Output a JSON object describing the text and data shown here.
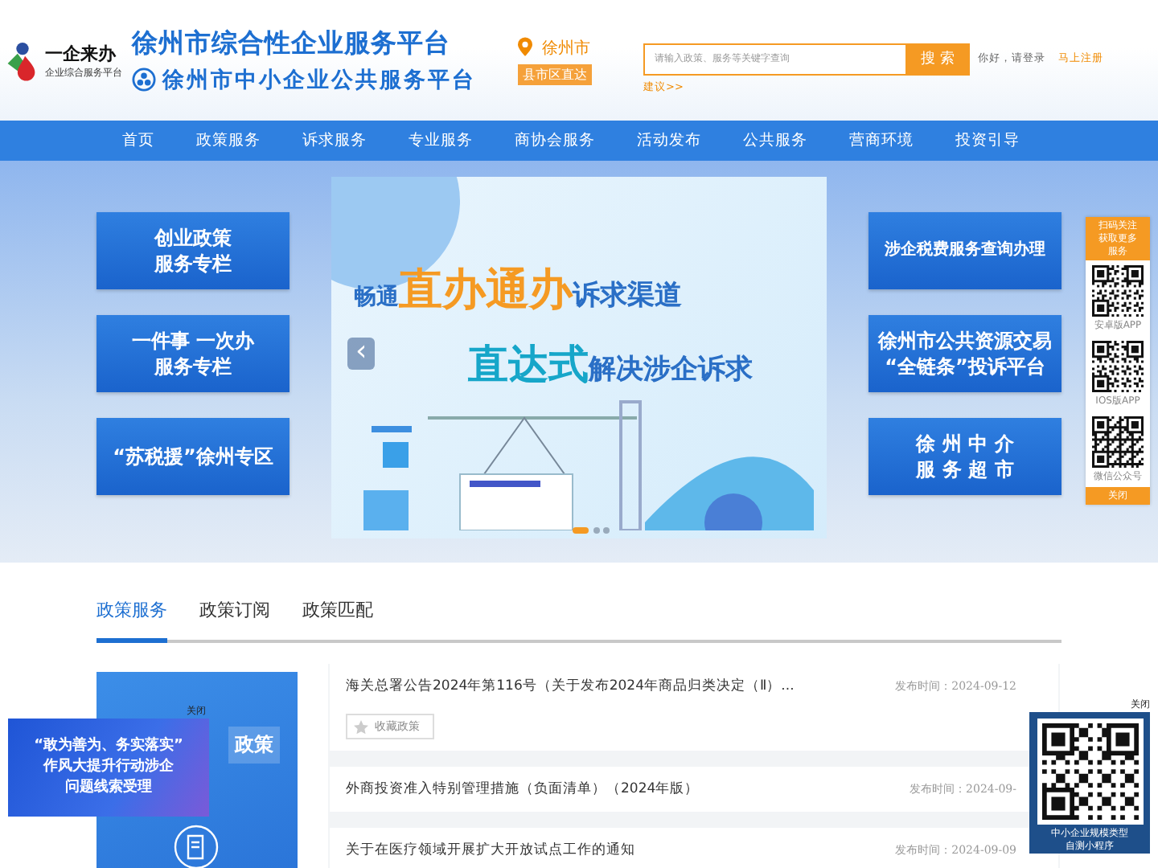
{
  "header": {
    "logo": {
      "name": "一企来办",
      "tagline": "企业综合服务平台"
    },
    "title": "徐州市综合性企业服务平台",
    "subtitle": "徐州市中小企业公共服务平台",
    "location": "徐州市",
    "location_badge": "县市区直达",
    "search": {
      "placeholder": "请输入政策、服务等关键字查询",
      "button": "搜 索"
    },
    "greeting": "你好，请登录",
    "register": "马上注册",
    "suggest": "建议>>"
  },
  "nav": [
    {
      "label": "首页",
      "selected": false
    },
    {
      "label": "政策服务",
      "selected": false
    },
    {
      "label": "诉求服务",
      "selected": false
    },
    {
      "label": "专业服务",
      "selected": false
    },
    {
      "label": "商协会服务",
      "selected": false
    },
    {
      "label": "活动发布",
      "selected": false
    },
    {
      "label": "公共服务",
      "selected": false
    },
    {
      "label": "营商环境",
      "selected": false
    },
    {
      "label": "投资引导",
      "selected": false
    }
  ],
  "banner": {
    "left_links": [
      [
        "创业政策",
        "服务专栏"
      ],
      [
        "一件事 一次办",
        "服务专栏"
      ],
      [
        "“苏税援”徐州专区"
      ]
    ],
    "slide": {
      "line1_prefix": "畅通",
      "line1_highlight": "直办通办",
      "line1_suffix": "诉求渠道",
      "line2_highlight": "直达式",
      "line2_suffix": "解决涉企诉求",
      "prev": "‹"
    },
    "right_links": [
      [
        "涉企税费服务查询办理"
      ],
      [
        "徐州市公共资源交易",
        "“全链条”投诉平台"
      ],
      [
        "徐 州 中 介",
        "服 务 超 市"
      ]
    ]
  },
  "qr_float": {
    "header": [
      "扫码关注",
      "获取更多",
      "服务"
    ],
    "items": [
      "安卓版APP",
      "IOS版APP",
      "微信公众号"
    ],
    "close": "关闭"
  },
  "policy": {
    "tabs": [
      {
        "label": "政策服务",
        "selected": true
      },
      {
        "label": "政策订阅",
        "selected": false
      },
      {
        "label": "政策匹配",
        "selected": false
      }
    ],
    "side_image_text": "政策",
    "items": [
      {
        "title": "海关总署公告2024年第116号（关于发布2024年商品归类决定（Ⅱ）...",
        "date": "发布时间：2024-09-12",
        "action": "收藏政策"
      },
      {
        "title": "外商投资准入特别管理措施（负面清单）（2024年版）",
        "date": "发布时间：2024-09-"
      },
      {
        "title": "关于在医疗领域开展扩大开放试点工作的通知",
        "date": "发布时间：2024-09-09"
      }
    ]
  },
  "popup": {
    "close": "关闭",
    "text": [
      "“敢为善为、务实落实”",
      "作风大提升行动涉企",
      "问题线索受理"
    ]
  },
  "mini_qr": {
    "close": "关闭",
    "caption": [
      "中小企业规模类型",
      "自测小程序"
    ]
  }
}
